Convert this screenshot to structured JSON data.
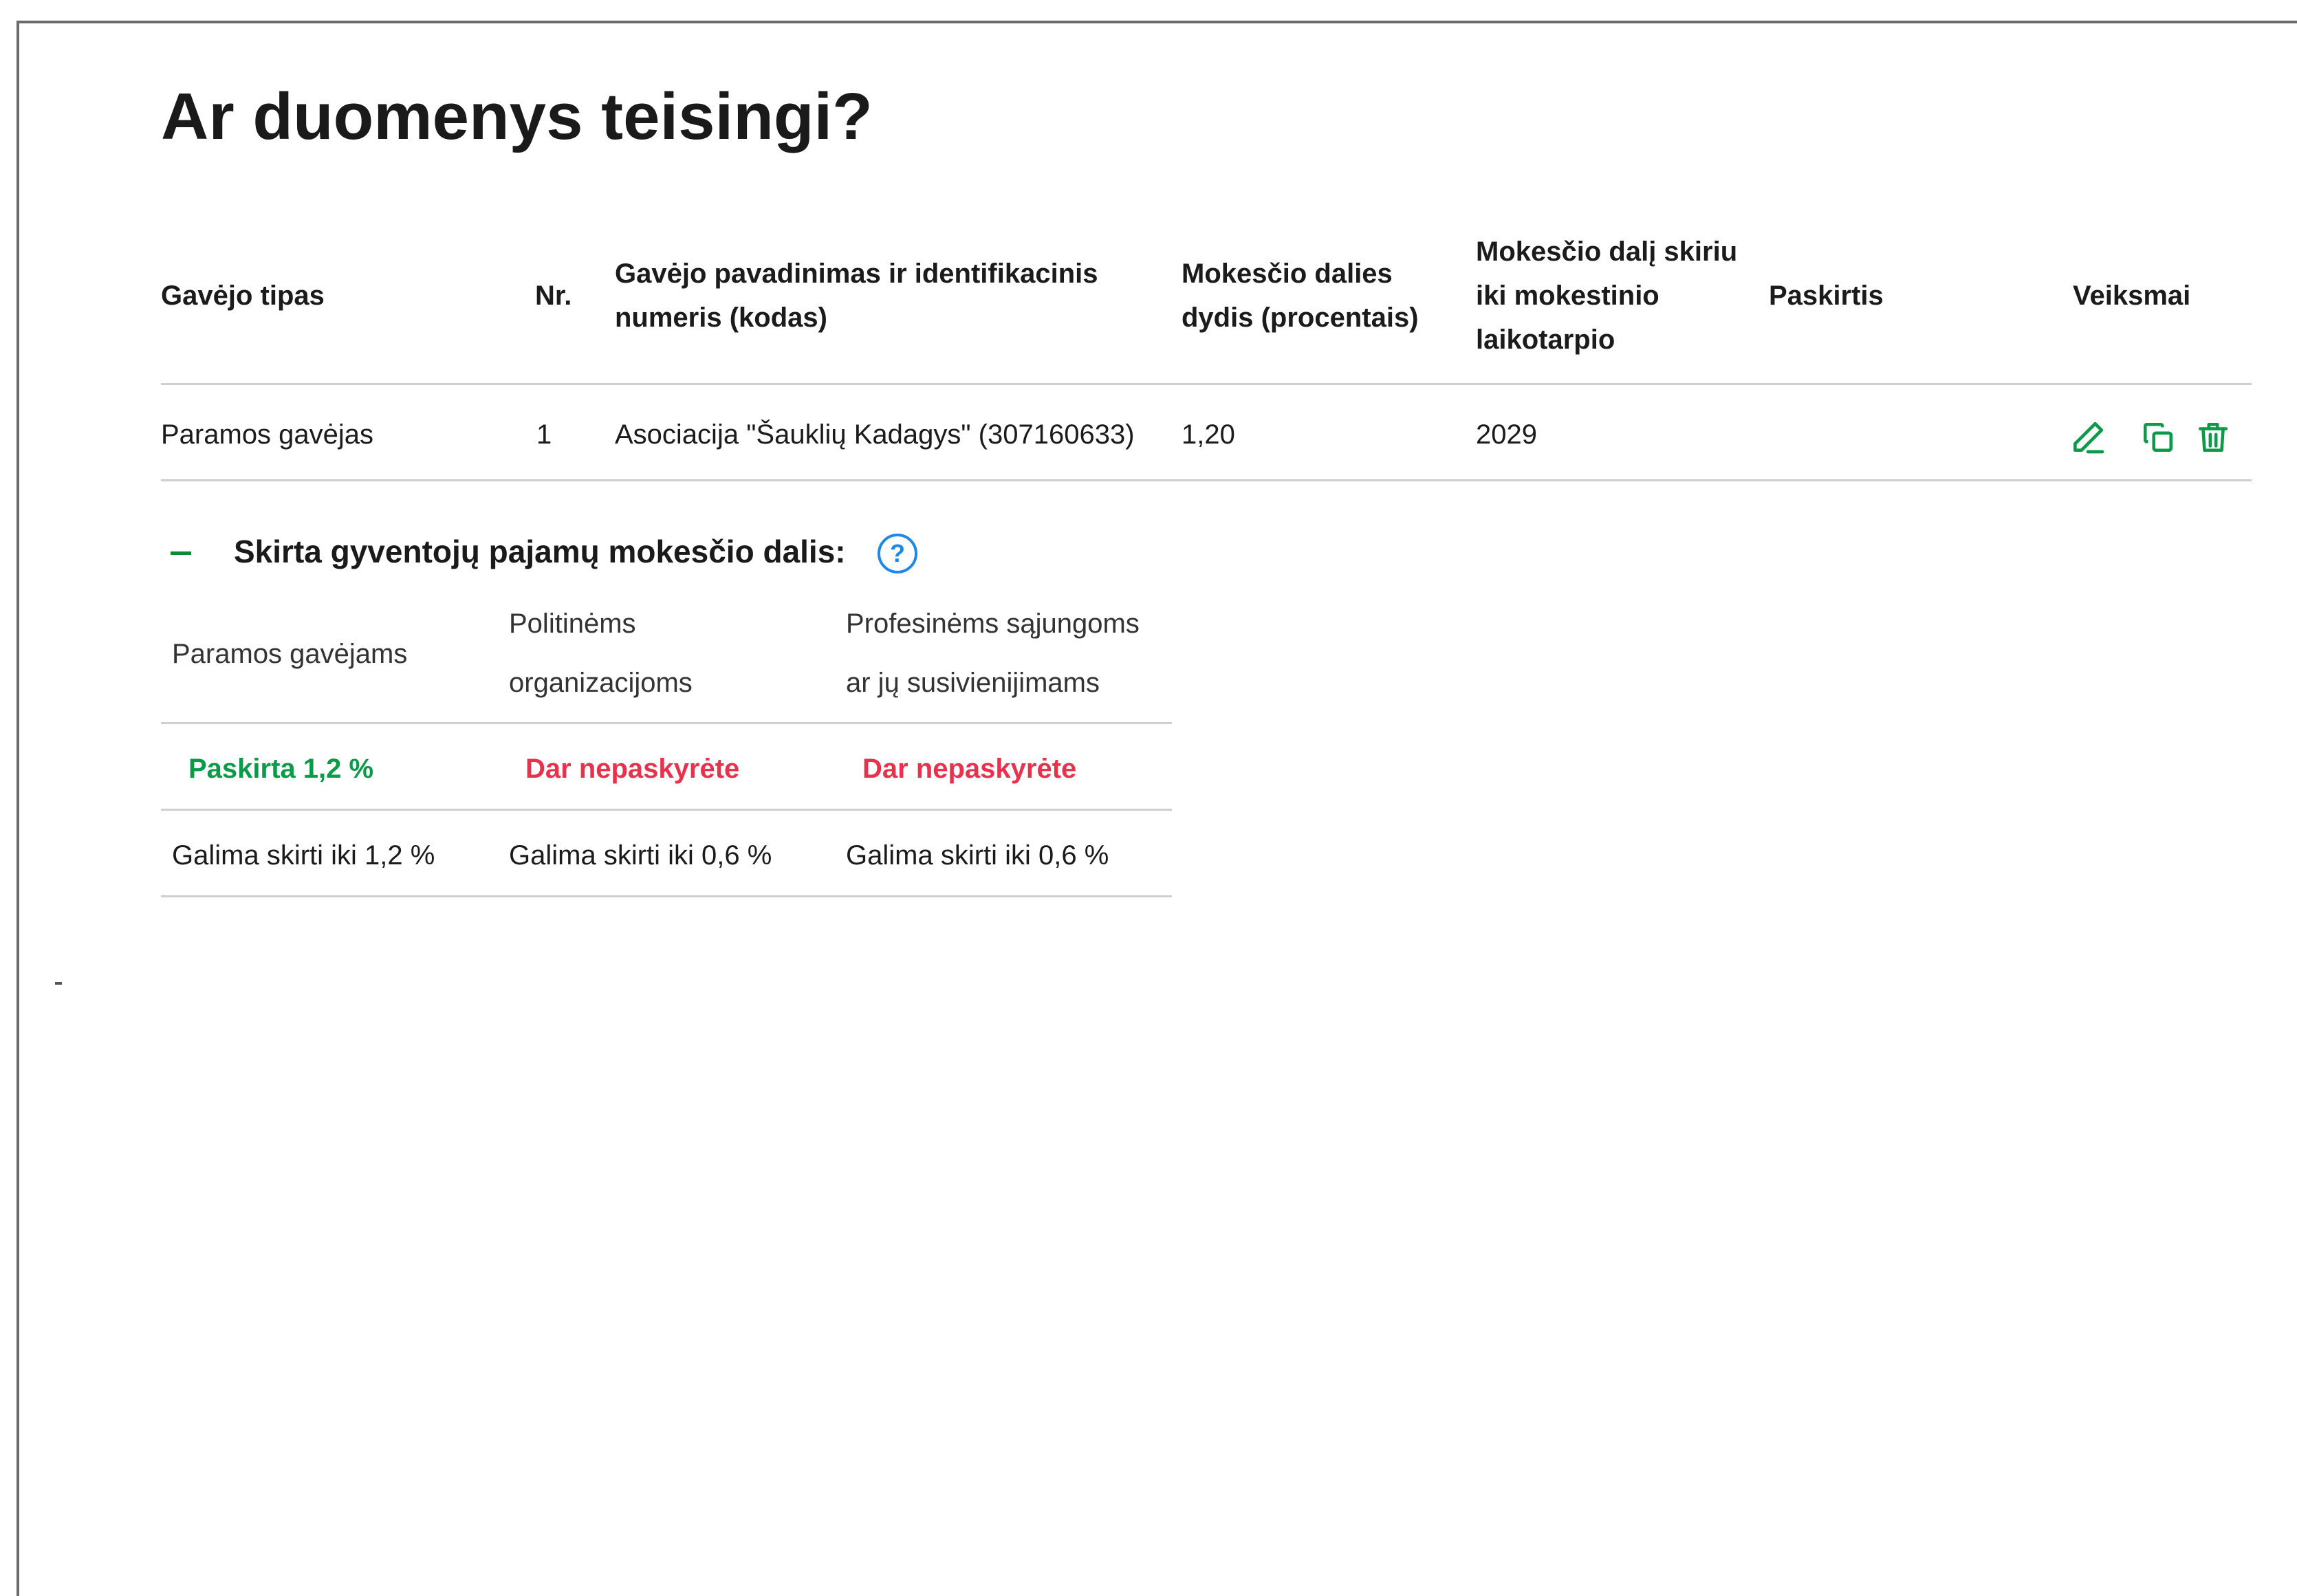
{
  "page": {
    "title": "Ar duomenys teisingi?"
  },
  "table": {
    "headers": {
      "type": "Gavėjo tipas",
      "nr": "Nr.",
      "name_line1": "Gavėjo pavadinimas ir identifikacinis",
      "name_line2": "numeris (kodas)",
      "share_line1": "Mokesčio dalies",
      "share_line2": "dydis (procentais)",
      "until_line1": "Mokesčio dalį skiriu",
      "until_line2": "iki mokestinio",
      "until_line3": "laikotarpio",
      "purpose": "Paskirtis",
      "actions": "Veiksmai"
    },
    "rows": [
      {
        "type": "Paramos gavėjas",
        "nr": "1",
        "name": "Asociacija \"Šauklių Kadagys\" (307160633)",
        "share": "1,20",
        "until": "2029",
        "purpose": ""
      }
    ],
    "action_icons": [
      "edit-icon",
      "copy-icon",
      "trash-icon"
    ]
  },
  "summary": {
    "title": "Skirta gyventojų pajamų mokesčio dalis:",
    "help_glyph": "?",
    "columns": [
      {
        "line1": "Paramos gavėjams",
        "line2": ""
      },
      {
        "line1": "Politinėms",
        "line2": "organizacijoms"
      },
      {
        "line1": "Profesinėms sąjungoms",
        "line2": "ar jų susivienijimams"
      }
    ],
    "status": [
      "Paskirta 1,2 %",
      "Dar nepaskyrėte",
      "Dar nepaskyrėte"
    ],
    "limits": [
      "Galima skirti iki 1,2 %",
      "Galima skirti iki 0,6 %",
      "Galima skirti iki 0,6 %"
    ]
  },
  "colors": {
    "accent_green": "#0b9a48",
    "alert_red": "#e8324d",
    "help_blue": "#1e88e5",
    "divider": "#cfcfcf"
  }
}
